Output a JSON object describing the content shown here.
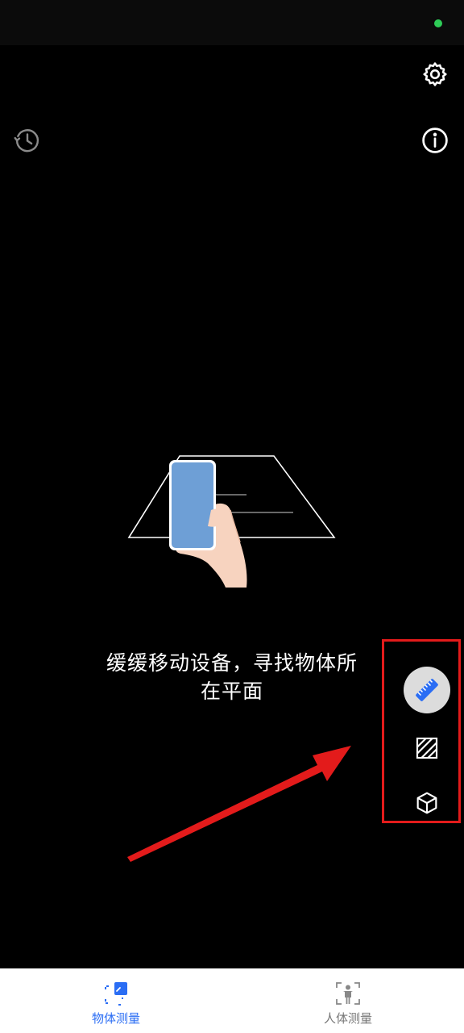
{
  "status_bar": {
    "indicator_color": "#2ecc57"
  },
  "header": {
    "history_icon": "history-icon",
    "settings_icon": "gear-icon",
    "info_icon": "info-icon"
  },
  "main": {
    "guidance_line1": "缓缓移动设备，寻找物体所",
    "guidance_line2": "在平面"
  },
  "mode_panel": {
    "highlight_color": "#e31b1b",
    "active_bg": "#dcdcdc",
    "accent": "#2a6df4",
    "modes": [
      {
        "icon": "ruler-icon",
        "active": true
      },
      {
        "icon": "area-icon",
        "active": false
      },
      {
        "icon": "cube-icon",
        "active": false
      }
    ]
  },
  "bottom_nav": {
    "tabs": [
      {
        "label": "物体测量",
        "icon": "object-measure-icon",
        "active": true
      },
      {
        "label": "人体测量",
        "icon": "body-measure-icon",
        "active": false
      }
    ],
    "active_color": "#2a6df4",
    "inactive_color": "#777777"
  }
}
